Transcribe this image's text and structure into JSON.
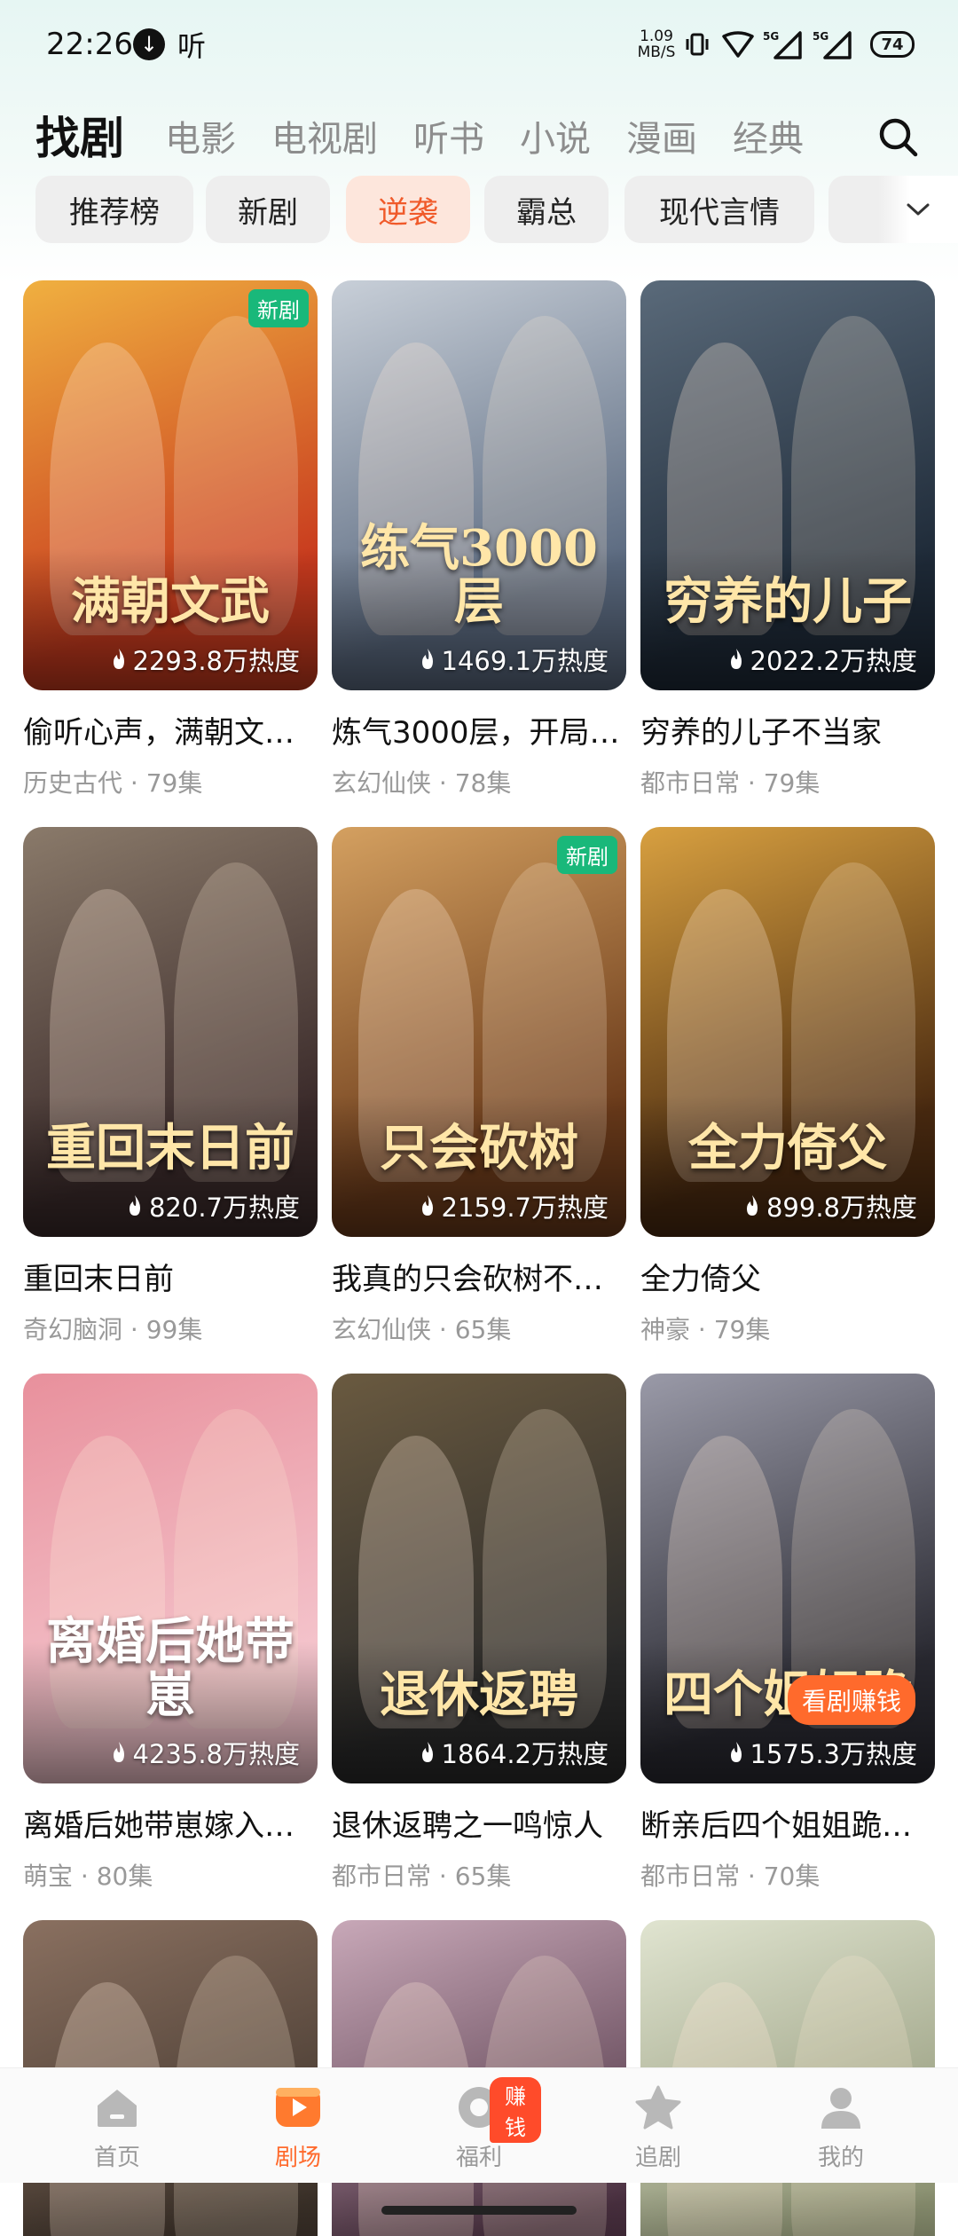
{
  "status_bar": {
    "time": "22:26",
    "listen_label": "听",
    "net_speed_value": "1.09",
    "net_speed_unit": "MB/S",
    "signal1_label": "5G",
    "signal2_label": "5G",
    "battery": "74"
  },
  "top_tabs": [
    {
      "label": "找剧",
      "active": true
    },
    {
      "label": "电影",
      "active": false
    },
    {
      "label": "电视剧",
      "active": false
    },
    {
      "label": "听书",
      "active": false
    },
    {
      "label": "小说",
      "active": false
    },
    {
      "label": "漫画",
      "active": false
    },
    {
      "label": "经典",
      "active": false
    }
  ],
  "chips": [
    {
      "label": "推荐榜",
      "active": false
    },
    {
      "label": "新剧",
      "active": false
    },
    {
      "label": "逆袭",
      "active": true
    },
    {
      "label": "霸总",
      "active": false
    },
    {
      "label": "现代言情",
      "active": false
    }
  ],
  "cards": [
    {
      "title": "偷听心声，满朝文…",
      "category": "历史古代",
      "episodes": "79集",
      "heat": "2293.8万热度",
      "badge": "新剧",
      "poster_text": "满朝文武",
      "colors": [
        "#c83a1e",
        "#f0b040"
      ]
    },
    {
      "title": "炼气3000层，开局…",
      "category": "玄幻仙侠",
      "episodes": "78集",
      "heat": "1469.1万热度",
      "badge": "",
      "poster_text": "练气3000层",
      "colors": [
        "#5b6a80",
        "#c8cfd8"
      ]
    },
    {
      "title": "穷养的儿子不当家",
      "category": "都市日常",
      "episodes": "79集",
      "heat": "2022.2万热度",
      "badge": "",
      "poster_text": "穷养的儿子",
      "colors": [
        "#1e2a38",
        "#5a6a7a"
      ]
    },
    {
      "title": "重回末日前",
      "category": "奇幻脑洞",
      "episodes": "99集",
      "heat": "820.7万热度",
      "badge": "",
      "poster_text": "重回末日前",
      "colors": [
        "#3a2a2a",
        "#8a7a6a"
      ]
    },
    {
      "title": "我真的只会砍树不…",
      "category": "玄幻仙侠",
      "episodes": "65集",
      "heat": "2159.7万热度",
      "badge": "新剧",
      "poster_text": "只会砍树",
      "colors": [
        "#6a3a1a",
        "#d4a060"
      ]
    },
    {
      "title": "全力倚父",
      "category": "神豪",
      "episodes": "79集",
      "heat": "899.8万热度",
      "badge": "",
      "poster_text": "全力倚父",
      "colors": [
        "#4a2a10",
        "#d8a040"
      ]
    },
    {
      "title": "离婚后她带崽嫁入…",
      "category": "萌宝",
      "episodes": "80集",
      "heat": "4235.8万热度",
      "badge": "",
      "poster_text": "离婚后她带崽",
      "colors": [
        "#f4c4cc",
        "#e8909c"
      ]
    },
    {
      "title": "退休返聘之一鸣惊人",
      "category": "都市日常",
      "episodes": "65集",
      "heat": "1864.2万热度",
      "badge": "",
      "poster_text": "退休返聘",
      "colors": [
        "#2a2a2a",
        "#6a5a40"
      ]
    },
    {
      "title": "断亲后四个姐姐跪…",
      "category": "都市日常",
      "episodes": "70集",
      "heat": "1575.3万热度",
      "badge": "看剧赚钱",
      "poster_text": "四个姐姐跪",
      "colors": [
        "#2a2a32",
        "#9a9aa8"
      ]
    },
    {
      "title": "",
      "category": "",
      "episodes": "",
      "heat": "",
      "badge": "",
      "poster_text": "",
      "colors": [
        "#3a3028",
        "#8a7060"
      ]
    },
    {
      "title": "",
      "category": "",
      "episodes": "",
      "heat": "",
      "badge": "",
      "poster_text": "",
      "colors": [
        "#4a3040",
        "#c8a8b8"
      ]
    },
    {
      "title": "",
      "category": "",
      "episodes": "",
      "heat": "",
      "badge": "",
      "poster_text": "",
      "colors": [
        "#8a9070",
        "#e0e4d0"
      ]
    }
  ],
  "bottom_nav": [
    {
      "label": "首页",
      "icon": "home-icon",
      "active": false
    },
    {
      "label": "剧场",
      "icon": "theater-icon",
      "active": true
    },
    {
      "label": "福利",
      "icon": "coin-icon",
      "active": false,
      "badge": "赚钱"
    },
    {
      "label": "追剧",
      "icon": "star-icon",
      "active": false
    },
    {
      "label": "我的",
      "icon": "user-icon",
      "active": false
    }
  ],
  "colors": {
    "accent": "#ff6a2c",
    "chip_active_bg": "#fde6dc",
    "new_badge": "#19b87a"
  }
}
